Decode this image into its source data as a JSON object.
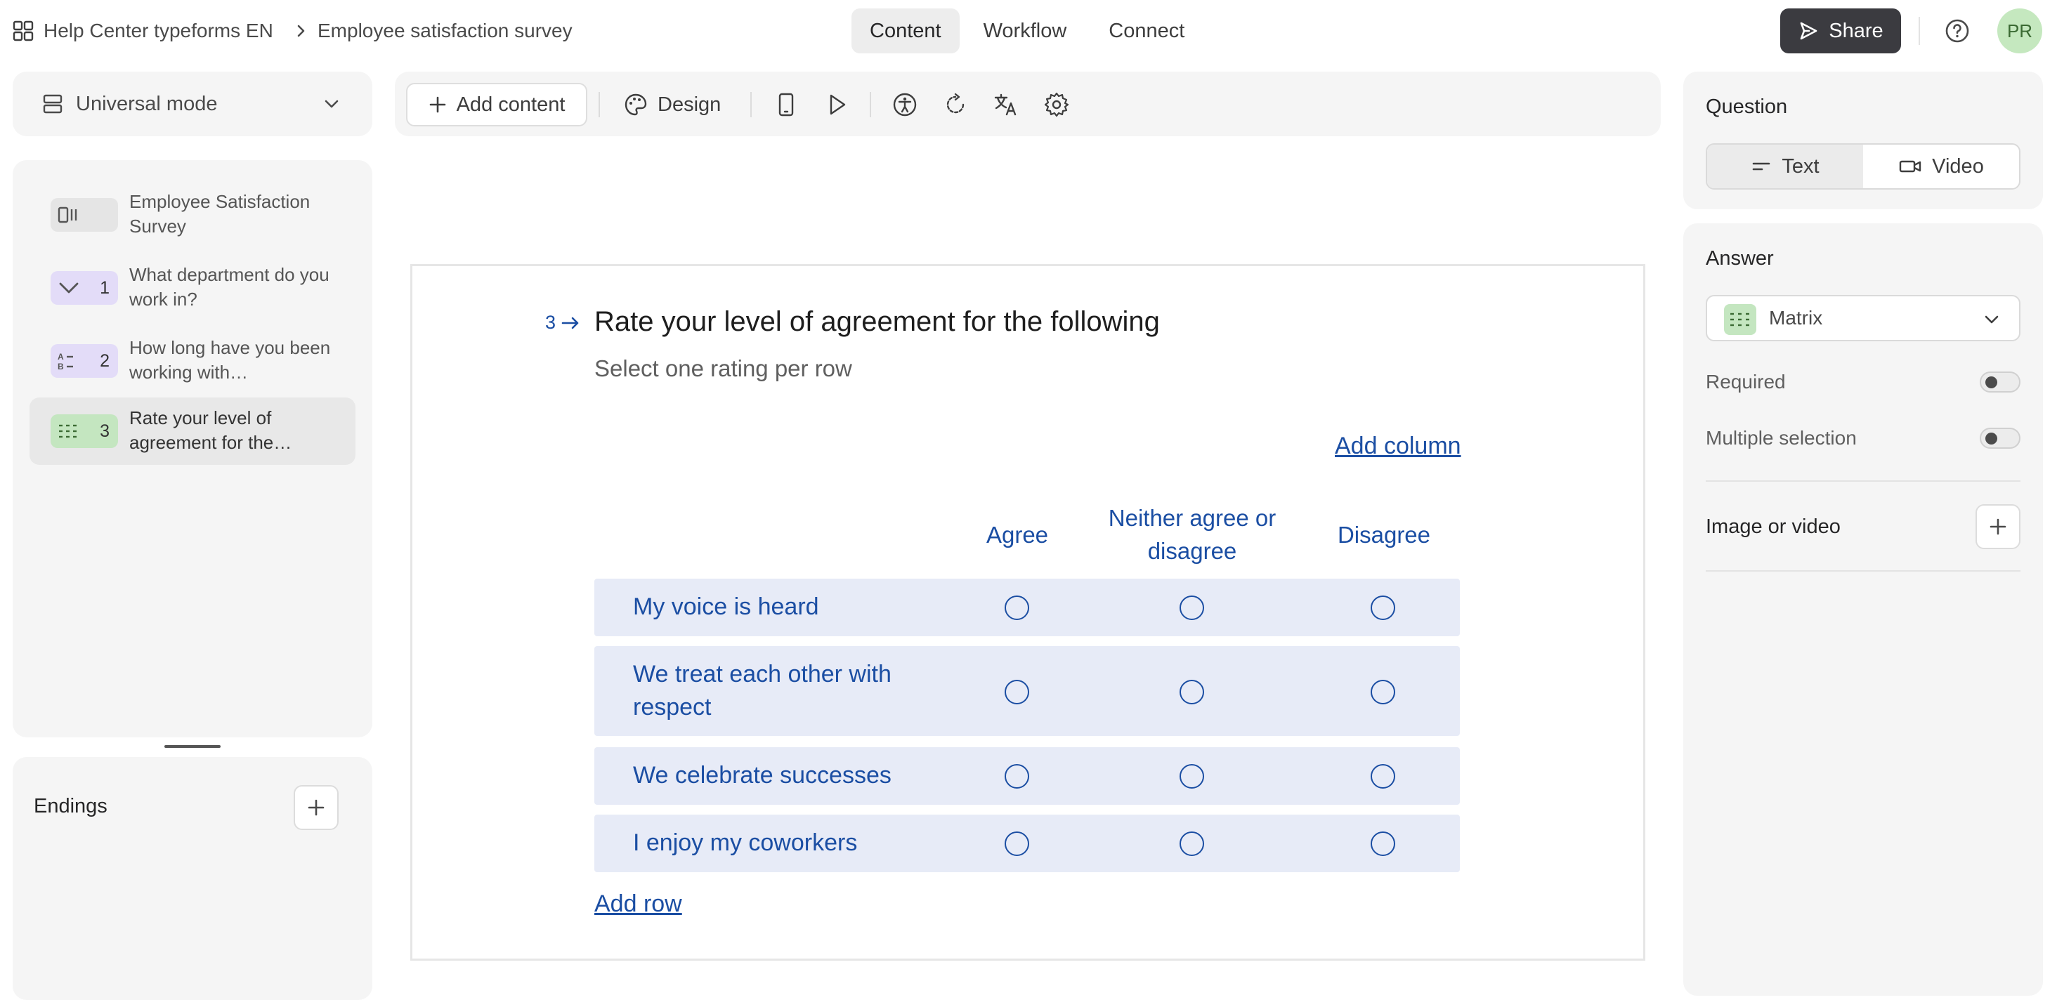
{
  "breadcrumb": {
    "workspace": "Help Center typeforms EN",
    "form": "Employee satisfaction survey"
  },
  "tabs": [
    {
      "label": "Content",
      "active": true
    },
    {
      "label": "Workflow",
      "active": false
    },
    {
      "label": "Connect",
      "active": false
    }
  ],
  "header": {
    "share_label": "Share",
    "avatar_initials": "PR"
  },
  "mode": {
    "label": "Universal mode"
  },
  "questions": [
    {
      "badge": "",
      "text": "Employee Satisfaction Survey",
      "icon": "welcome-screen-icon",
      "badge_color": "#e5e5e5"
    },
    {
      "badge": "1",
      "text": "What department do you work in?",
      "icon": "dropdown-chevron-icon",
      "badge_color": "#e3dcf8"
    },
    {
      "badge": "2",
      "text": "How long have you been working with…",
      "icon": "multiple-choice-icon",
      "badge_color": "#e3dcf8"
    },
    {
      "badge": "3",
      "text": "Rate your level of agreement for the…",
      "icon": "matrix-icon",
      "badge_color": "#c4e6c0",
      "selected": true
    }
  ],
  "endings": {
    "label": "Endings"
  },
  "toolbar": {
    "add_content_label": "Add content",
    "design_label": "Design"
  },
  "canvas": {
    "question_number": "3",
    "title": "Rate your level of agreement for the following",
    "description": "Select one rating per row",
    "add_column_label": "Add column",
    "add_row_label": "Add row",
    "columns": [
      "Agree",
      "Neither agree or disagree",
      "Disagree"
    ],
    "rows": [
      "My voice is heard",
      "We treat each other with respect",
      "We celebrate successes",
      "I enjoy my coworkers"
    ]
  },
  "right_panel": {
    "question_heading": "Question",
    "text_tab": "Text",
    "video_tab": "Video",
    "answer_heading": "Answer",
    "answer_type": "Matrix",
    "required_label": "Required",
    "required_on": false,
    "multiple_label": "Multiple selection",
    "multiple_on": false,
    "media_label": "Image or video"
  },
  "colors": {
    "accent_blue": "#1b4ea3",
    "row_bg": "#e7ebf7",
    "share_bg": "#3b3b40",
    "matrix_green": "#c4e6c0",
    "choice_purple": "#e3dcf8"
  }
}
